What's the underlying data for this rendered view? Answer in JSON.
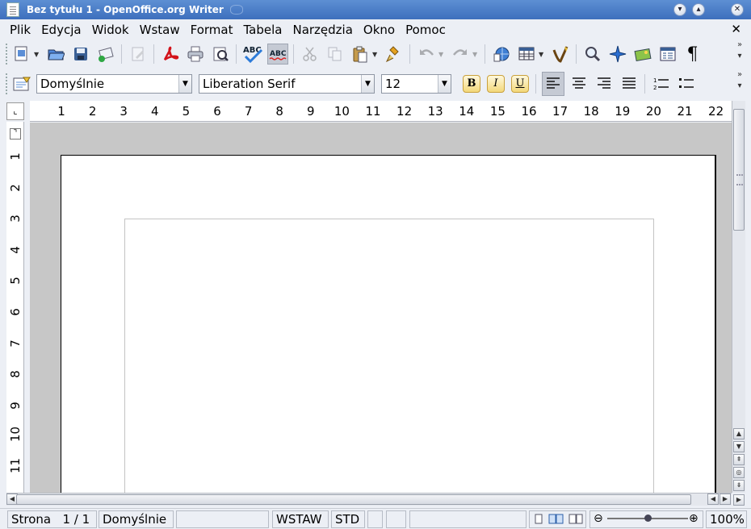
{
  "window": {
    "title": "Bez tytułu 1 - OpenOffice.org Writer",
    "app_icon": "document-icon",
    "buttons": [
      "chevron-down-icon",
      "chevron-up-icon",
      "close-icon"
    ]
  },
  "menu": {
    "items": [
      "Plik",
      "Edycja",
      "Widok",
      "Wstaw",
      "Format",
      "Tabela",
      "Narzędzia",
      "Okno",
      "Pomoc"
    ],
    "close_doc": "✕"
  },
  "toolbar_standard": {
    "icons": [
      "new-document-icon",
      "open-folder-icon",
      "save-icon",
      "send-mail-icon",
      "edit-file-icon",
      "export-pdf-icon",
      "print-icon",
      "page-preview-icon",
      "spellcheck-icon",
      "autospellcheck-icon",
      "cut-icon",
      "copy-icon",
      "paste-icon",
      "clone-formatting-icon",
      "undo-icon",
      "redo-icon",
      "hyperlink-icon",
      "table-icon",
      "draw-functions-icon",
      "find-replace-icon",
      "navigator-icon",
      "gallery-icon",
      "data-sources-icon",
      "formatting-marks-icon"
    ],
    "spell_label": "ABC",
    "autospell_label": "ABC",
    "pilcrow": "¶"
  },
  "toolbar_formatting": {
    "style_value": "Domyślnie",
    "font_value": "Liberation Serif",
    "size_value": "12",
    "bold": "B",
    "italic": "I",
    "underline": "U",
    "icons": [
      "styles-formatting-icon",
      "align-left-icon",
      "align-center-icon",
      "align-right-icon",
      "justify-icon",
      "numbering-icon",
      "bullets-icon"
    ]
  },
  "ruler": {
    "horizontal": [
      "1",
      "2",
      "3",
      "4",
      "5",
      "6",
      "7",
      "8",
      "9",
      "10",
      "11",
      "12",
      "13",
      "14",
      "15",
      "16",
      "17",
      "18",
      "19",
      "20",
      "21",
      "22"
    ],
    "vertical": [
      "1",
      "2",
      "3",
      "4",
      "5",
      "6",
      "7",
      "8",
      "9",
      "10",
      "11"
    ]
  },
  "status": {
    "page_label": "Strona",
    "page_value": "1 / 1",
    "page_style": "Domyślnie",
    "insert_mode": "WSTAW",
    "selection_mode": "STD",
    "zoom": "100%",
    "zoom_level": 1.0
  }
}
